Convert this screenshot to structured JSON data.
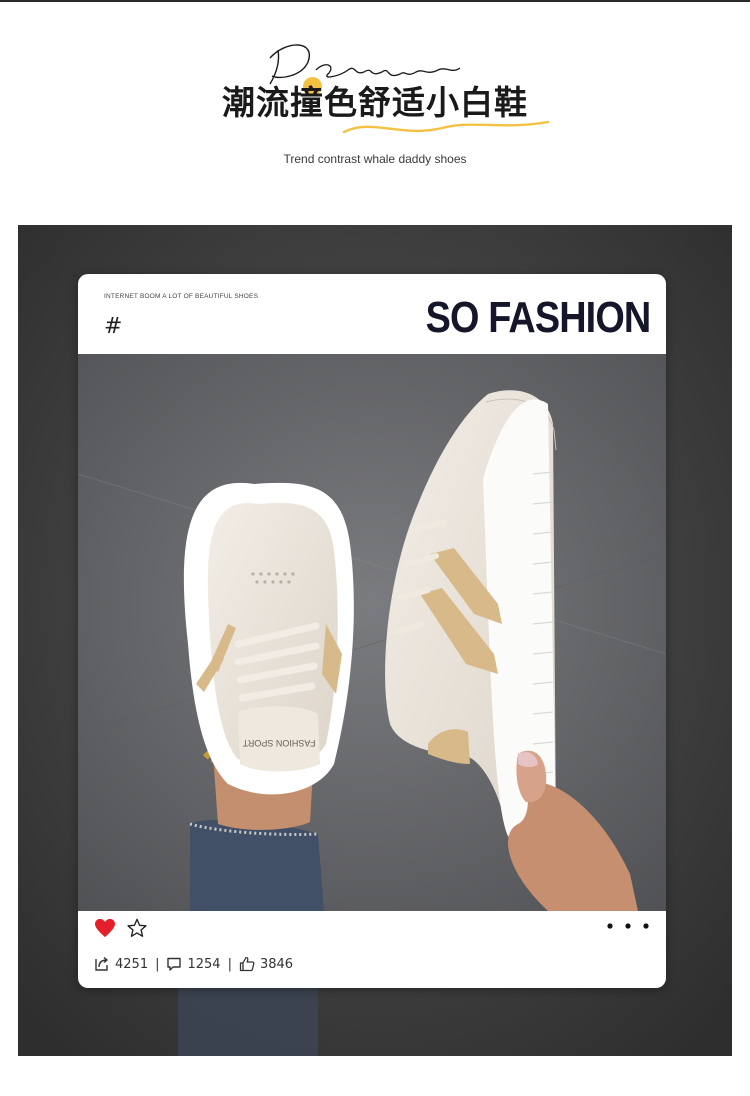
{
  "header": {
    "script_word": "Design",
    "title": "潮流撞色舒适小白鞋",
    "subtitle": "Trend contrast whale daddy shoes"
  },
  "card": {
    "tagline": "INTERNET BOOM A LOT OF BEAUTIFUL SHOES",
    "hashtag": "#",
    "brand": "SO FASHION",
    "tongue_label": "FASHION SPORT"
  },
  "social": {
    "shares": "4251",
    "comments": "1254",
    "likes": "3846",
    "separator": "|"
  },
  "icons": [
    "heart-icon",
    "star-icon",
    "more-dots-icon",
    "share-icon",
    "comment-icon",
    "thumbs-up-icon"
  ],
  "colors": {
    "accent_yellow": "#f4c242",
    "heart_red": "#e41e2b",
    "brand_navy": "#15162a",
    "shoe_tan": "#d8b98a"
  }
}
